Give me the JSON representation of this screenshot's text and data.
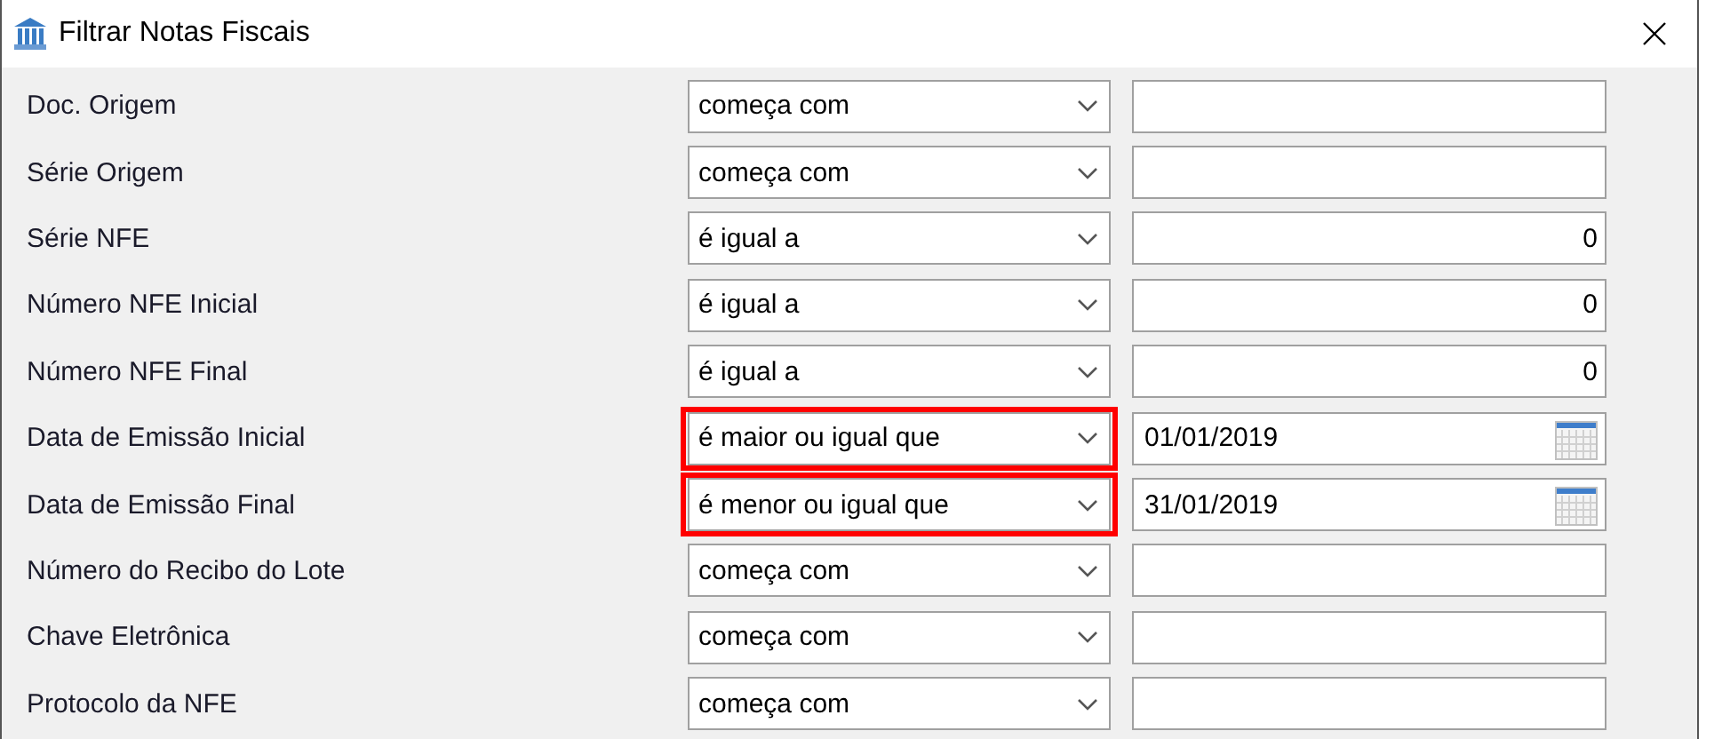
{
  "window": {
    "title": "Filtrar Notas Fiscais"
  },
  "filters": [
    {
      "label": "Doc. Origem",
      "operator": "começa com",
      "highlighted": false,
      "kind": "text"
    },
    {
      "label": "Série Origem",
      "operator": "começa com",
      "highlighted": false,
      "kind": "text"
    },
    {
      "label": "Série NFE",
      "operator": "é igual a",
      "highlighted": false,
      "kind": "number",
      "value": "0"
    },
    {
      "label": "Número NFE Inicial",
      "operator": "é igual a",
      "highlighted": false,
      "kind": "number",
      "value": "0"
    },
    {
      "label": "Número NFE Final",
      "operator": "é igual a",
      "highlighted": false,
      "kind": "number",
      "value": "0"
    },
    {
      "label": "Data de Emissão Inicial",
      "operator": "é maior ou igual que",
      "highlighted": true,
      "kind": "date",
      "value": "01/01/2019"
    },
    {
      "label": "Data de Emissão Final",
      "operator": "é menor ou igual que",
      "highlighted": true,
      "kind": "date",
      "value": "31/01/2019"
    },
    {
      "label": "Número do Recibo do Lote",
      "operator": "começa com",
      "highlighted": false,
      "kind": "text"
    },
    {
      "label": "Chave Eletrônica",
      "operator": "começa com",
      "highlighted": false,
      "kind": "text"
    },
    {
      "label": "Protocolo da NFE",
      "operator": "começa com",
      "highlighted": false,
      "kind": "text"
    }
  ]
}
